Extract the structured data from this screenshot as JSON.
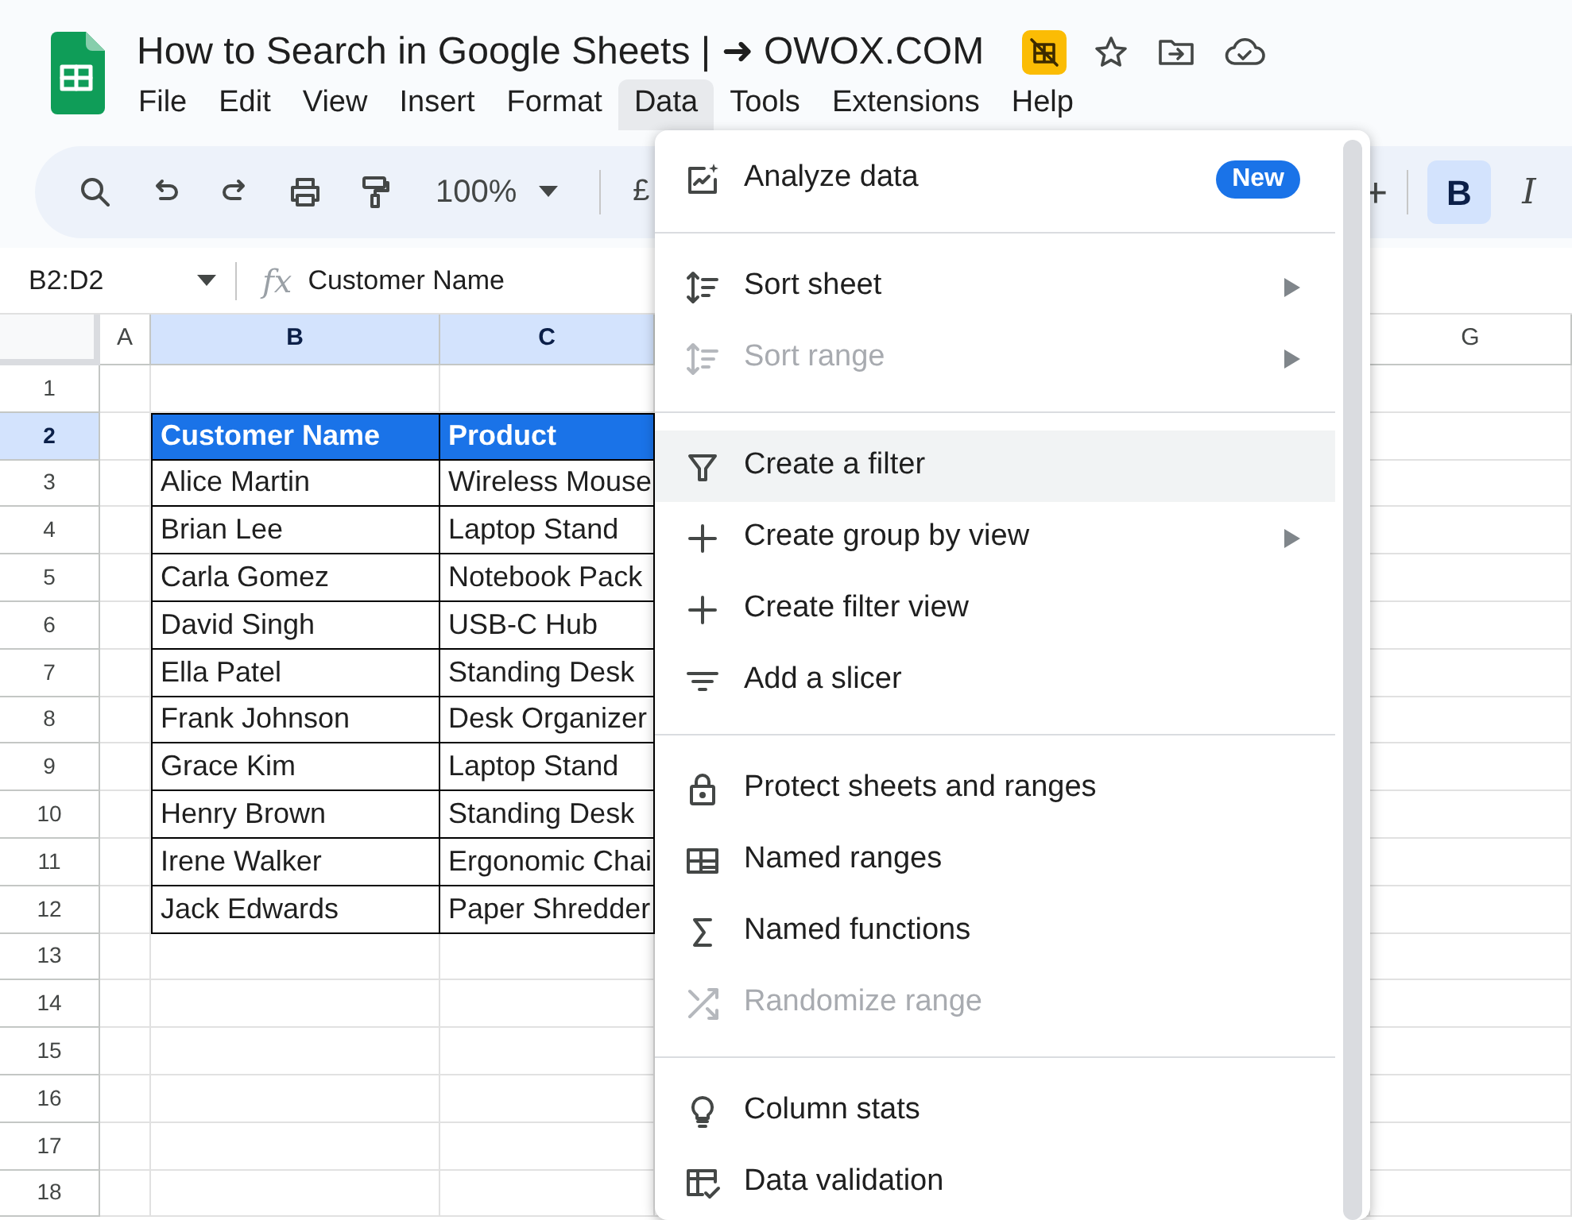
{
  "window": {
    "title": "How to Search in Google Sheets | ➜ OWOX.COM"
  },
  "menubar": [
    {
      "label": "File",
      "selected": false
    },
    {
      "label": "Edit",
      "selected": false
    },
    {
      "label": "View",
      "selected": false
    },
    {
      "label": "Insert",
      "selected": false
    },
    {
      "label": "Format",
      "selected": false
    },
    {
      "label": "Data",
      "selected": true
    },
    {
      "label": "Tools",
      "selected": false
    },
    {
      "label": "Extensions",
      "selected": false
    },
    {
      "label": "Help",
      "selected": false
    }
  ],
  "toolbar": {
    "zoom": "100%",
    "currency": "£",
    "more": "+",
    "format_buttons": [
      {
        "label": "B",
        "on": true
      },
      {
        "label": "I",
        "on": false
      }
    ]
  },
  "formula_bar": {
    "name_box": "B2:D2",
    "fx": "fx",
    "formula": "Customer Name"
  },
  "columns": [
    {
      "label": "A",
      "selected": false
    },
    {
      "label": "B",
      "selected": true
    },
    {
      "label": "C",
      "selected": true
    },
    {
      "label": "G",
      "selected": false
    }
  ],
  "row_numbers": [
    {
      "label": "1",
      "selected": false
    },
    {
      "label": "2",
      "selected": true
    },
    {
      "label": "3",
      "selected": false
    },
    {
      "label": "4",
      "selected": false
    },
    {
      "label": "5",
      "selected": false
    },
    {
      "label": "6",
      "selected": false
    },
    {
      "label": "7",
      "selected": false
    },
    {
      "label": "8",
      "selected": false
    },
    {
      "label": "9",
      "selected": false
    },
    {
      "label": "10",
      "selected": false
    },
    {
      "label": "11",
      "selected": false
    },
    {
      "label": "12",
      "selected": false
    },
    {
      "label": "13",
      "selected": false
    },
    {
      "label": "14",
      "selected": false
    },
    {
      "label": "15",
      "selected": false
    },
    {
      "label": "16",
      "selected": false
    },
    {
      "label": "17",
      "selected": false
    },
    {
      "label": "18",
      "selected": false
    }
  ],
  "table": {
    "header": [
      "Customer Name",
      "Product"
    ],
    "rows": [
      [
        "Alice Martin",
        "Wireless Mouse"
      ],
      [
        "Brian Lee",
        "Laptop Stand"
      ],
      [
        "Carla Gomez",
        "Notebook Pack"
      ],
      [
        "David Singh",
        "USB-C Hub"
      ],
      [
        "Ella Patel",
        "Standing Desk"
      ],
      [
        "Frank Johnson",
        "Desk Organizer"
      ],
      [
        "Grace Kim",
        "Laptop Stand"
      ],
      [
        "Henry Brown",
        "Standing Desk"
      ],
      [
        "Irene Walker",
        "Ergonomic Chai"
      ],
      [
        "Jack Edwards",
        "Paper Shredder"
      ]
    ]
  },
  "data_menu": {
    "items": [
      {
        "kind": "item",
        "label": "Analyze data",
        "badge": "New",
        "disabled": false,
        "highlighted": false,
        "submenu": false
      },
      {
        "kind": "separator"
      },
      {
        "kind": "item",
        "label": "Sort sheet",
        "disabled": false,
        "highlighted": false,
        "submenu": true
      },
      {
        "kind": "item",
        "label": "Sort range",
        "disabled": true,
        "highlighted": false,
        "submenu": true
      },
      {
        "kind": "separator"
      },
      {
        "kind": "item",
        "label": "Create a filter",
        "disabled": false,
        "highlighted": true,
        "submenu": false
      },
      {
        "kind": "item",
        "label": "Create group by view",
        "disabled": false,
        "highlighted": false,
        "submenu": true
      },
      {
        "kind": "item",
        "label": "Create filter view",
        "disabled": false,
        "highlighted": false,
        "submenu": false
      },
      {
        "kind": "item",
        "label": "Add a slicer",
        "disabled": false,
        "highlighted": false,
        "submenu": false
      },
      {
        "kind": "separator"
      },
      {
        "kind": "item",
        "label": "Protect sheets and ranges",
        "disabled": false,
        "highlighted": false,
        "submenu": false
      },
      {
        "kind": "item",
        "label": "Named ranges",
        "disabled": false,
        "highlighted": false,
        "submenu": false
      },
      {
        "kind": "item",
        "label": "Named functions",
        "disabled": false,
        "highlighted": false,
        "submenu": false
      },
      {
        "kind": "item",
        "label": "Randomize range",
        "disabled": true,
        "highlighted": false,
        "submenu": false
      },
      {
        "kind": "separator"
      },
      {
        "kind": "item",
        "label": "Column stats",
        "disabled": false,
        "highlighted": false,
        "submenu": false
      },
      {
        "kind": "item",
        "label": "Data validation",
        "disabled": false,
        "highlighted": false,
        "submenu": false
      }
    ]
  }
}
